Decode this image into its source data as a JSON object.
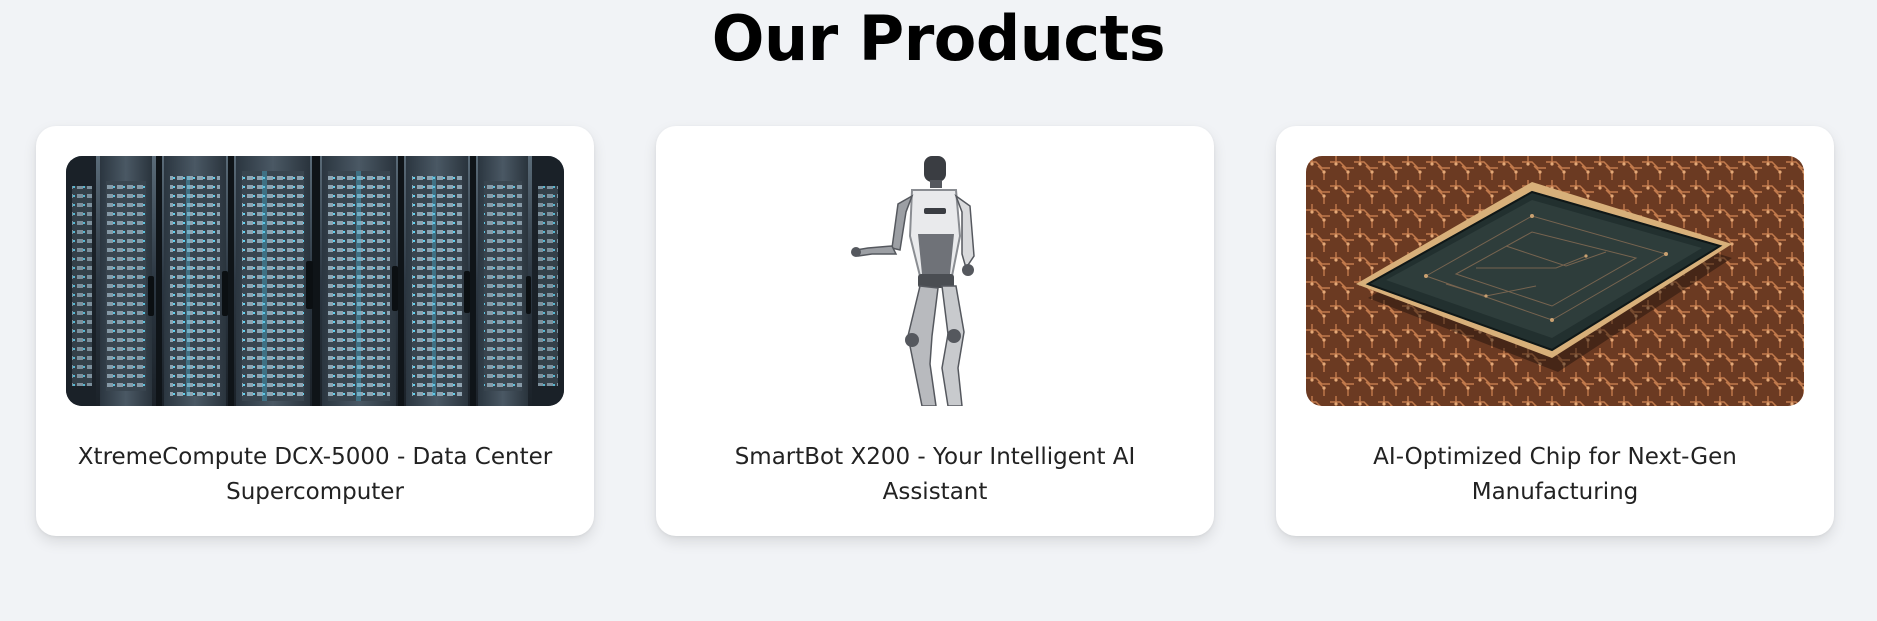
{
  "section": {
    "title": "Our Products"
  },
  "products": [
    {
      "title": "XtremeCompute DCX-5000 - Data Center Supercomputer",
      "image": "server-racks-image"
    },
    {
      "title": "SmartBot X200 - Your Intelligent AI Assistant",
      "image": "humanoid-robot-image"
    },
    {
      "title": "AI-Optimized Chip for Next-Gen Manufacturing",
      "image": "microchip-image"
    }
  ],
  "colors": {
    "background": "#f1f3f6",
    "card": "#ffffff",
    "text": "#222222",
    "server_glow": "#4cc4e8",
    "circuit_copper": "#b06a40"
  }
}
